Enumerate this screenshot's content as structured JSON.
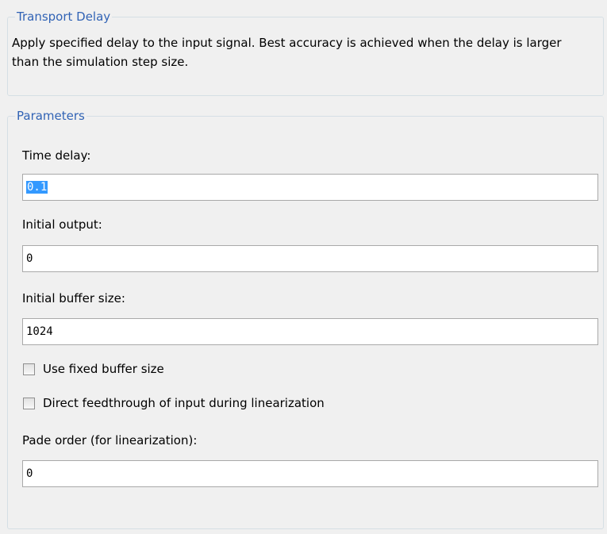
{
  "description": {
    "legend": "Transport Delay",
    "text": "Apply specified delay to the input signal.  Best accuracy is achieved when the delay is larger than the simulation step size."
  },
  "parameters": {
    "legend": "Parameters",
    "time_delay": {
      "label": "Time delay:",
      "value": "0.1"
    },
    "initial_output": {
      "label": "Initial output:",
      "value": "0"
    },
    "initial_buffer_size": {
      "label": "Initial buffer size:",
      "value": "1024"
    },
    "use_fixed_buffer": {
      "label": "Use fixed buffer size",
      "checked": false
    },
    "direct_feedthrough": {
      "label": "Direct feedthrough of input during linearization",
      "checked": false
    },
    "pade_order": {
      "label": "Pade order (for linearization):",
      "value": "0"
    }
  },
  "colors": {
    "legend": "#3163b5",
    "background": "#f0f0f0",
    "selection": "#3399ff"
  }
}
